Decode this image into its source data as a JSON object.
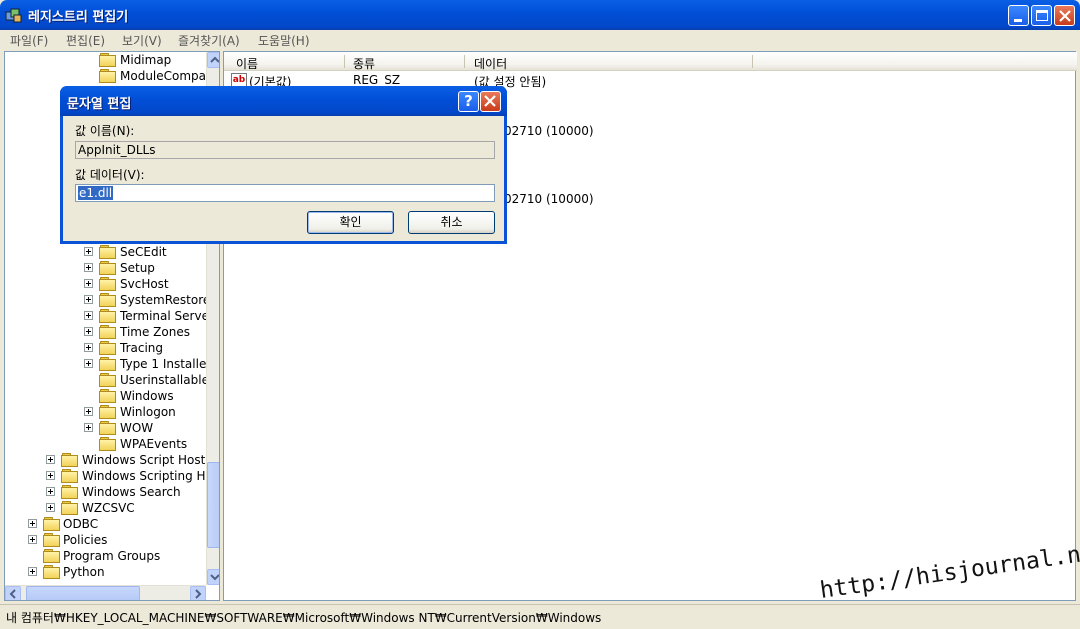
{
  "window": {
    "title": "레지스트리 편집기"
  },
  "menu": [
    "파일(F)",
    "편집(E)",
    "보기(V)",
    "즐겨찾기(A)",
    "도움말(H)"
  ],
  "tree": {
    "items": [
      {
        "label": "Midimap",
        "expandable": false
      },
      {
        "label": "ModuleCompa",
        "expandable": false
      },
      {
        "label": "SeCEdit",
        "expandable": true
      },
      {
        "label": "Setup",
        "expandable": true
      },
      {
        "label": "SvcHost",
        "expandable": true
      },
      {
        "label": "SystemRestore",
        "expandable": true
      },
      {
        "label": "Terminal Serve",
        "expandable": true
      },
      {
        "label": "Time Zones",
        "expandable": true
      },
      {
        "label": "Tracing",
        "expandable": true
      },
      {
        "label": "Type 1 Installe",
        "expandable": true
      },
      {
        "label": "Userinstallable",
        "expandable": false
      },
      {
        "label": "Windows",
        "expandable": false
      },
      {
        "label": "Winlogon",
        "expandable": true
      },
      {
        "label": "WOW",
        "expandable": true
      },
      {
        "label": "WPAEvents",
        "expandable": false
      },
      {
        "label": "Windows Script Host",
        "expandable": true
      },
      {
        "label": "Windows Scripting Ho",
        "expandable": true
      },
      {
        "label": "Windows Search",
        "expandable": true
      },
      {
        "label": "WZCSVC",
        "expandable": true
      },
      {
        "label": "ODBC",
        "expandable": true
      },
      {
        "label": "Policies",
        "expandable": true
      },
      {
        "label": "Program Groups",
        "expandable": false
      },
      {
        "label": "Python",
        "expandable": true
      }
    ]
  },
  "list": {
    "columns": [
      "이름",
      "종류",
      "데이터"
    ],
    "default_name": "(기본값)",
    "default_type": "REG_SZ",
    "default_data": "(값 설정 안됨)",
    "partial_data_1": "02710 (10000)",
    "partial_data_2": "02710 (10000)"
  },
  "dialog": {
    "title": "문자열 편집",
    "help": "?",
    "name_label": "값 이름(N):",
    "name_value": "AppInit_DLLs",
    "data_label": "값 데이터(V):",
    "data_value": "e1.dll",
    "ok_label": "확인",
    "cancel_label": "취소"
  },
  "status": {
    "path": "내 컴퓨터₩HKEY_LOCAL_MACHINE₩SOFTWARE₩Microsoft₩Windows NT₩CurrentVersion₩Windows"
  },
  "watermark": "http://hisjournal.net",
  "colors": {
    "titlebar": "#0150d8",
    "selection": "#316ac5",
    "chrome": "#ece9d8"
  }
}
